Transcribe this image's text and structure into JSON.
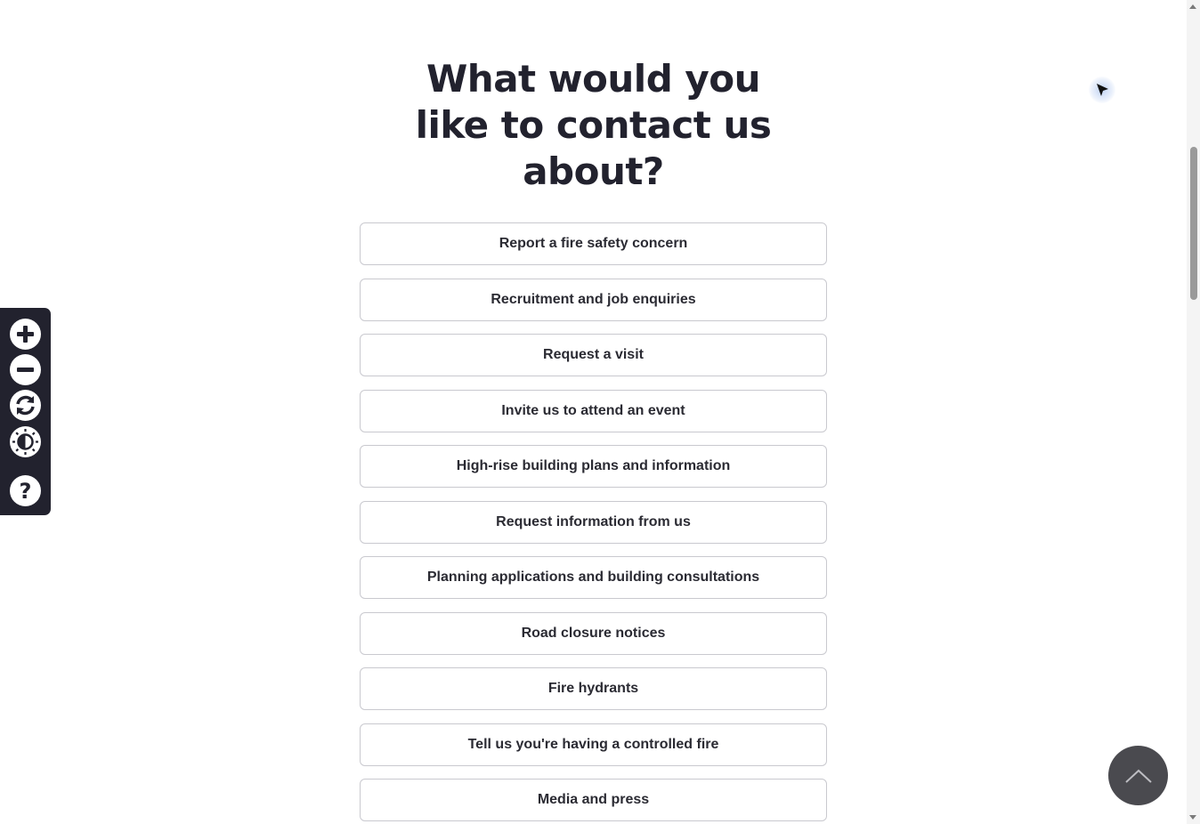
{
  "top_clip": {
    "link_text": "",
    "trailing_text": ""
  },
  "heading": {
    "line1": "What would you",
    "line2": "like to contact us",
    "line3": "about?"
  },
  "options": [
    "Report a fire safety concern",
    "Recruitment and job enquiries",
    "Request a visit",
    "Invite us to attend an event",
    "High-rise building plans and information",
    "Request information from us",
    "Planning applications and building consultations",
    "Road closure notices",
    "Fire hydrants",
    "Tell us you're having a controlled fire",
    "Media and press"
  ],
  "accessibility_toolbar": {
    "icons": [
      "plus-icon",
      "minus-icon",
      "refresh-icon",
      "contrast-icon",
      "help-icon"
    ]
  },
  "colors": {
    "heading": "#22222e",
    "toolbar_bg": "#22222e",
    "link_underline": "#c8102e",
    "back_to_top_bg": "#4a4a4f"
  }
}
